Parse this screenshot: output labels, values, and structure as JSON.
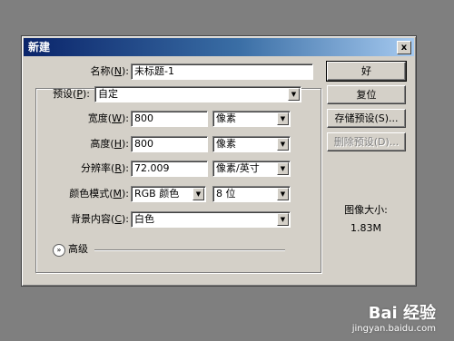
{
  "dialog": {
    "title": "新建",
    "close_label": "x",
    "name": {
      "label_pre": "名称(",
      "key": "N",
      "label_post": "):",
      "value": "未标题-1"
    },
    "preset": {
      "label_pre": "预设(",
      "key": "P",
      "label_post": "):",
      "value": "自定"
    },
    "width": {
      "label_pre": "宽度(",
      "key": "W",
      "label_post": "):",
      "value": "800",
      "unit": "像素"
    },
    "height": {
      "label_pre": "高度(",
      "key": "H",
      "label_post": "):",
      "value": "800",
      "unit": "像素"
    },
    "resolution": {
      "label_pre": "分辨率(",
      "key": "R",
      "label_post": "):",
      "value": "72.009",
      "unit": "像素/英寸"
    },
    "color_mode": {
      "label_pre": "颜色模式(",
      "key": "M",
      "label_post": "):",
      "value": "RGB 颜色",
      "depth": "8 位"
    },
    "background": {
      "label_pre": "背景内容(",
      "key": "C",
      "label_post": "):",
      "value": "白色"
    },
    "advanced": {
      "label": "高级",
      "icon": "chevron-double-down-icon"
    },
    "buttons": {
      "ok": "好",
      "reset": "复位",
      "save_preset": "存储预设(S)...",
      "delete_preset": "删除预设(D)..."
    },
    "image_size": {
      "label": "图像大小:",
      "value": "1.83M"
    }
  },
  "watermark": {
    "brand": "Bai 经验",
    "url": "jingyan.baidu.com"
  }
}
